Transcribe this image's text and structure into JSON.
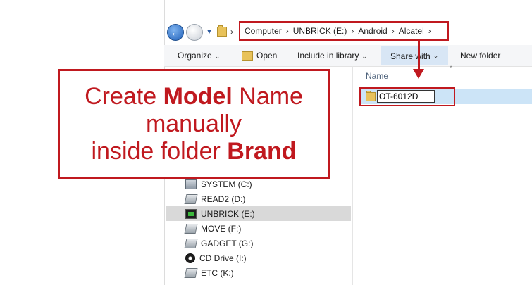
{
  "address_bar": {
    "crumbs": [
      "Computer",
      "UNBRICK (E:)",
      "Android",
      "Alcatel"
    ],
    "separator": "›"
  },
  "toolbar": {
    "organize": "Organize",
    "open": "Open",
    "include_in_library": "Include in library",
    "share_with": "Share with",
    "new_folder": "New folder",
    "caret": "⌄"
  },
  "file_list": {
    "column_name": "Name",
    "rename_value": "OT-6012D"
  },
  "nav_pane": {
    "items": [
      {
        "label": "SYSTEM (C:)",
        "icon": "system-drive-icon"
      },
      {
        "label": "READ2 (D:)",
        "icon": "hard-drive-icon"
      },
      {
        "label": "UNBRICK (E:)",
        "icon": "usb-drive-icon",
        "selected": true
      },
      {
        "label": "MOVE (F:)",
        "icon": "hard-drive-icon"
      },
      {
        "label": "GADGET (G:)",
        "icon": "hard-drive-icon"
      },
      {
        "label": "CD Drive (I:)",
        "icon": "cd-drive-icon"
      },
      {
        "label": "ETC (K:)",
        "icon": "hard-drive-icon"
      }
    ]
  },
  "callout": {
    "line1_prefix": "Create ",
    "line1_bold": "Model",
    "line1_suffix": " Name",
    "line2": "manually",
    "line3_prefix": "inside folder ",
    "line3_bold": "Brand"
  },
  "colors": {
    "annotation_red": "#c0191f",
    "selection_blue": "#cce4f7",
    "nav_selected": "#d9d9d9"
  }
}
